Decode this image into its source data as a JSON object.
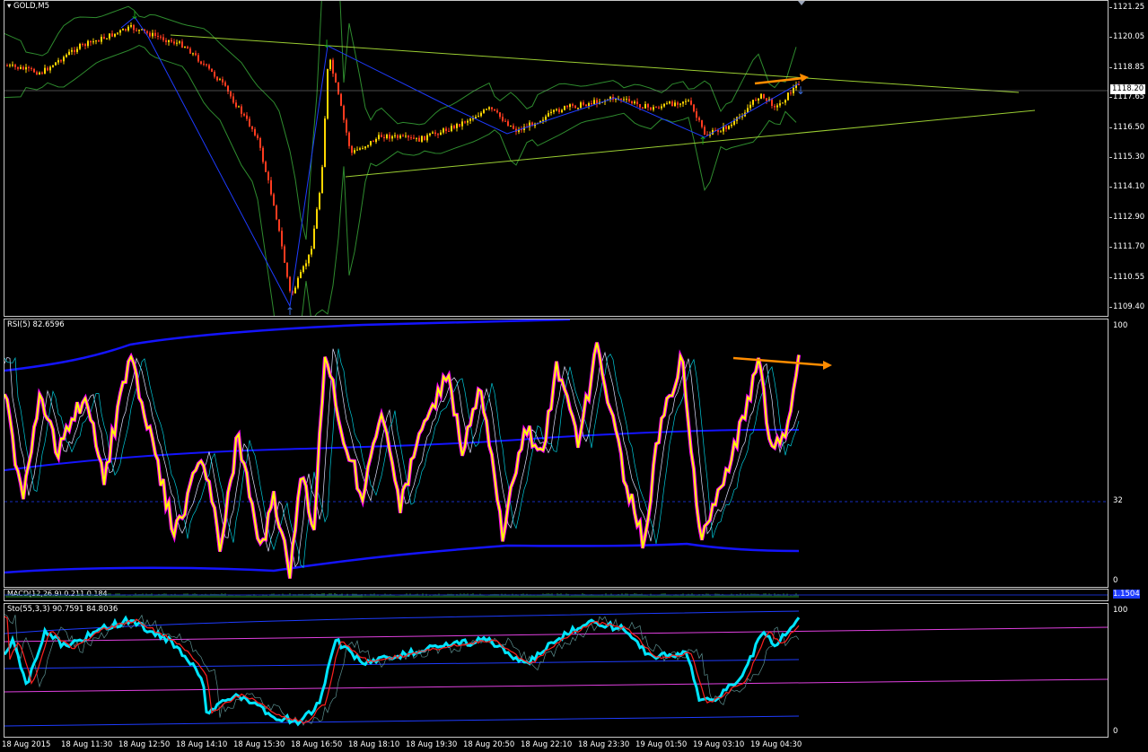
{
  "main": {
    "title": "GOLD,M5",
    "price_labels": [
      "1121.25",
      "1120.05",
      "1118.85",
      "1117.65",
      "1116.50",
      "1115.30",
      "1114.10",
      "1112.90",
      "1111.70",
      "1110.55",
      "1109.40"
    ],
    "current_price": "1118.20"
  },
  "rsi": {
    "title": "RSI(5) 82.6596",
    "labels": [
      "100",
      "32",
      "0"
    ]
  },
  "macd": {
    "title": "MACD(12,26,9) 0.211 0.184",
    "labels": [
      "1.1504"
    ]
  },
  "sto": {
    "title": "Sto(55,3,3) 90.7591 84.8036",
    "labels": [
      "100",
      "0"
    ]
  },
  "time_labels": [
    "18 Aug 2015",
    "18 Aug 11:30",
    "18 Aug 12:50",
    "18 Aug 14:10",
    "18 Aug 15:30",
    "18 Aug 16:50",
    "18 Aug 18:10",
    "18 Aug 19:30",
    "18 Aug 20:50",
    "18 Aug 22:10",
    "18 Aug 23:30",
    "19 Aug 01:50",
    "19 Aug 03:10",
    "19 Aug 04:30"
  ],
  "colors": {
    "bull_candle": "#ffd700",
    "bear_candle": "#ff3b1f",
    "trendline": "#9acd32",
    "zigzag": "#1e3cff",
    "bands": "#2e8b2e",
    "rsi_main": "#ffff00",
    "rsi_glow": "#ff00ff",
    "rsi_band": "#1414ff",
    "arrow": "#ff8c00",
    "sto_main": "#00e5ff",
    "sto_signal": "#ff2020",
    "sto_level": "#e040e0"
  }
}
